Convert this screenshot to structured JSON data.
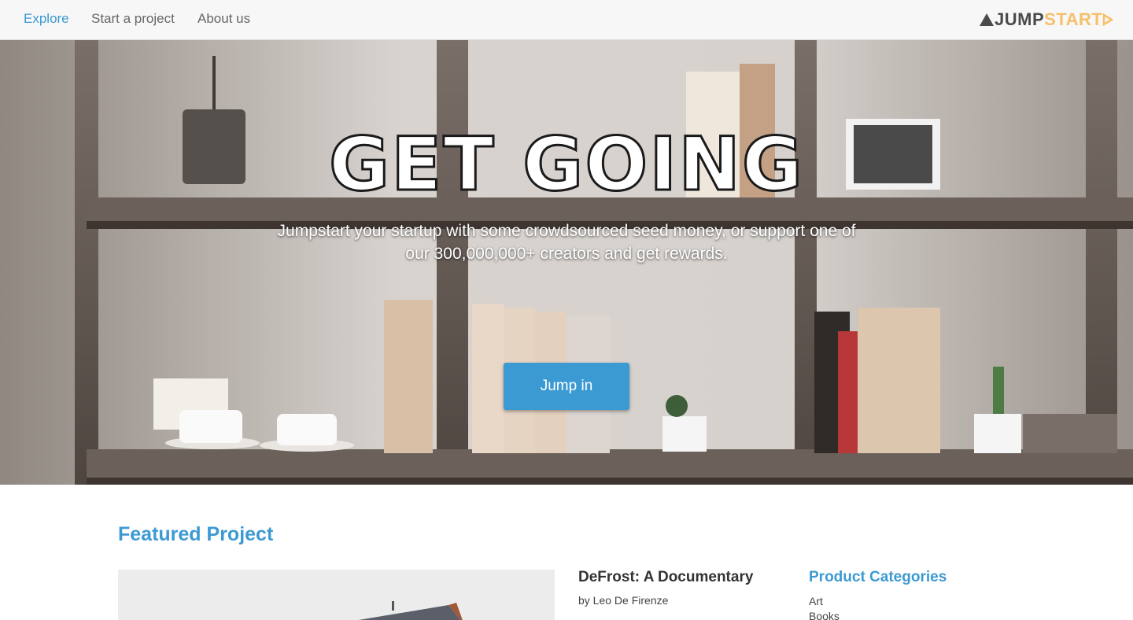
{
  "nav": {
    "links": [
      {
        "label": "Explore",
        "active": true
      },
      {
        "label": "Start a project",
        "active": false
      },
      {
        "label": "About us",
        "active": false
      }
    ],
    "logo": {
      "part1": "JUMP",
      "part2": "START"
    }
  },
  "hero": {
    "title": "GET GOING",
    "subtitle": "Jumpstart your startup with some crowdsourced seed money, or support one of our 300,000,000+ creators and get rewards.",
    "button_label": "Jump in"
  },
  "featured": {
    "heading": "Featured Project",
    "project_title": "DeFrost: A Documentary",
    "project_author": "by Leo De Firenze"
  },
  "categories": {
    "heading": "Product Categories",
    "items": [
      "Art",
      "Books"
    ]
  },
  "colors": {
    "accent": "#3c9ad3",
    "logo_dark": "#4a4a4a",
    "logo_light": "#f5c06a"
  }
}
